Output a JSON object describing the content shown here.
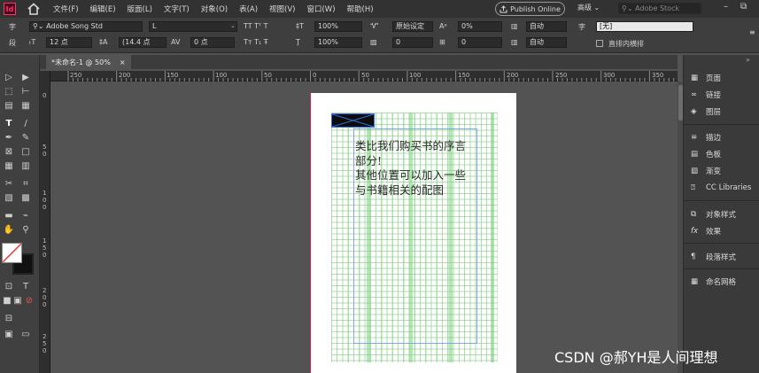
{
  "app": {
    "logo": "Id"
  },
  "menu": [
    "文件(F)",
    "编辑(E)",
    "版面(L)",
    "文字(T)",
    "对象(O)",
    "表(A)",
    "视图(V)",
    "窗口(W)",
    "帮助(H)"
  ],
  "publish_label": "Publish Online",
  "workspace_label": "高级",
  "stock_placeholder": "Adobe Stock",
  "control": {
    "font_family": "Adobe Song Std",
    "font_style": "L",
    "font_size": "12 点",
    "leading": "(14.4 点",
    "tracking_label": "0 点",
    "hscale": "100%",
    "vscale": "100%",
    "proofing": "原始设定",
    "baseline": "0%",
    "skew": "0°",
    "auto1": "自动",
    "auto2": "自动",
    "char_style": "[无]",
    "straight_label": "直排内横排",
    "spacing0": "0",
    "spacing1": "0"
  },
  "tab": {
    "title": "*未命名-1 @ 50%",
    "close": "×"
  },
  "ruler_h": [
    "250",
    "200",
    "150",
    "100",
    "50",
    "0",
    "50",
    "100",
    "150",
    "200",
    "250",
    "300",
    "350"
  ],
  "ruler_v": [
    "0",
    "5",
    "0",
    "1",
    "0",
    "0",
    "1",
    "5",
    "0",
    "2",
    "0",
    "0",
    "2",
    "5",
    "0"
  ],
  "page_text": [
    "类比我们购买书的序言",
    "部分!",
    "其他位置可以加入一些",
    "与书籍相关的配图"
  ],
  "panels": {
    "group1": [
      "页面",
      "链接",
      "图层"
    ],
    "group2": [
      "描边",
      "色板",
      "渐变",
      "CC Libraries"
    ],
    "group3": [
      "对象样式",
      "效果"
    ],
    "group4": [
      "段落样式"
    ],
    "group5": [
      "命名网格"
    ]
  },
  "watermark": "CSDN @郝YH是人间理想",
  "colors": {
    "accent": "#ff3366",
    "grid": "#8cd78c",
    "guide": "#7aa7ee"
  }
}
